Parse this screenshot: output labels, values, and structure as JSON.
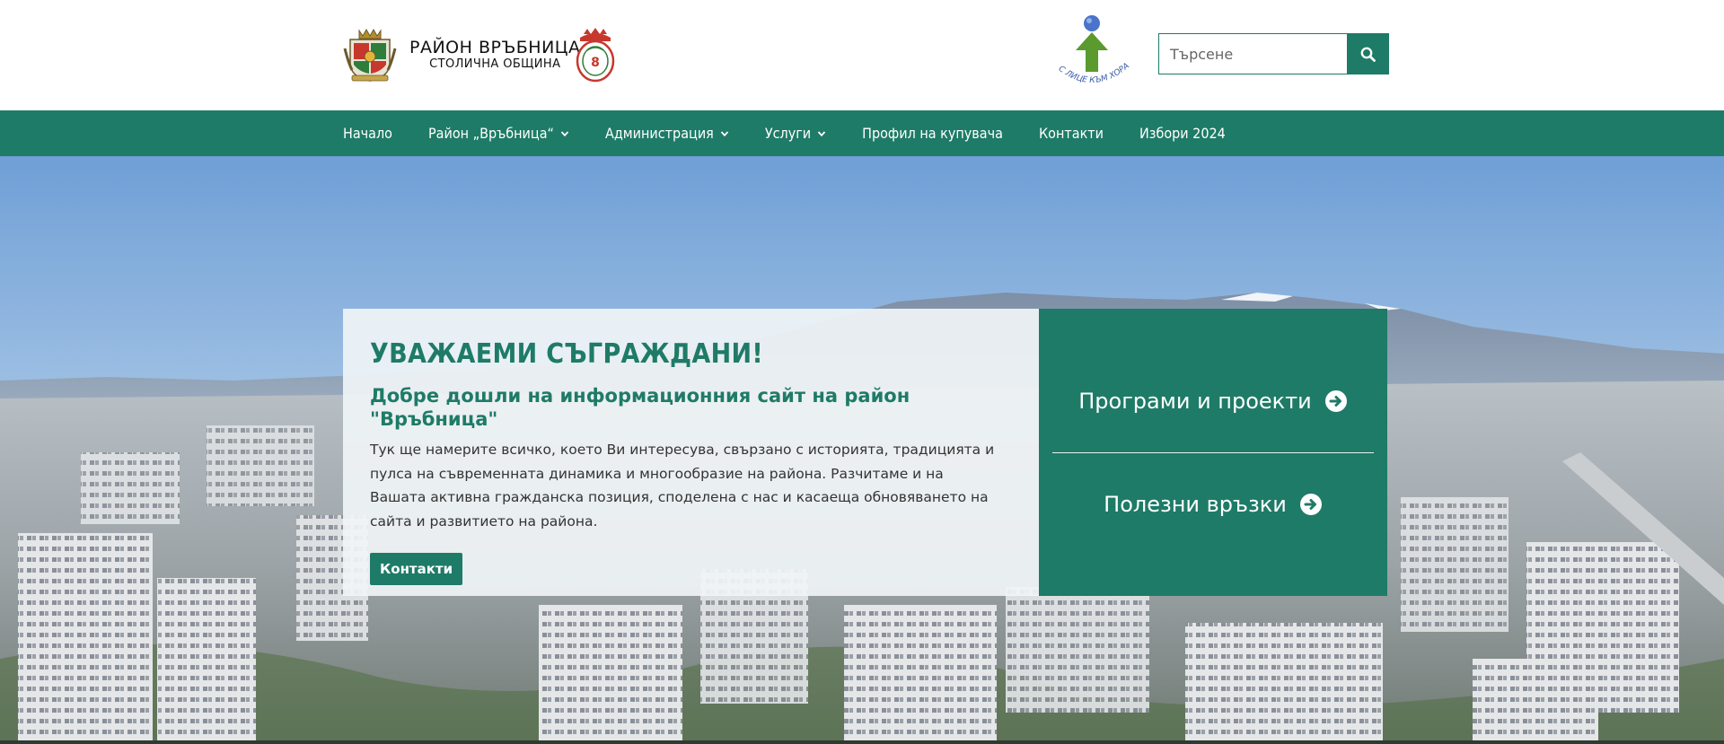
{
  "header": {
    "brand_title": "РАЙОН ВРЪБНИЦА",
    "brand_subtitle": "СТОЛИЧНА ОБЩИНА",
    "gov_logo_text": "С ЛИЦЕ КЪМ ХОРАТА",
    "search": {
      "placeholder": "Търсене",
      "value": ""
    }
  },
  "nav": {
    "items": [
      {
        "label": "Начало",
        "has_dropdown": false
      },
      {
        "label": "Район „Връбница“",
        "has_dropdown": true
      },
      {
        "label": "Администрация",
        "has_dropdown": true
      },
      {
        "label": "Услуги",
        "has_dropdown": true
      },
      {
        "label": "Профил на купувача",
        "has_dropdown": false
      },
      {
        "label": "Контакти",
        "has_dropdown": false
      },
      {
        "label": "Избори 2024",
        "has_dropdown": false
      }
    ]
  },
  "hero": {
    "heading": "УВАЖАЕМИ СЪГРАЖДАНИ!",
    "subheading": "Добре дошли на информационния сайт на район \"Връбница\"",
    "body": "Тук ще намерите всичко, което Ви интересува, свързано с историята, традицията и пулса на съвременната динамика и многообразие на района. Разчитаме и на Вашата активна гражданска позиция, споделена с нас и касаеща обновяването на сайта и развитието на района.",
    "button_label": "Контакти",
    "links": [
      {
        "label": "Програми и проекти"
      },
      {
        "label": "Полезни връзки"
      }
    ]
  },
  "colors": {
    "primary": "#1e7b67",
    "header_bg": "#ffffff",
    "welcome_panel_bg": "#f0f4f6",
    "text": "#333333"
  },
  "icons": {
    "search": "search-icon",
    "caret": "chevron-down-icon",
    "link_arrow": "circle-arrow-right-icon"
  }
}
